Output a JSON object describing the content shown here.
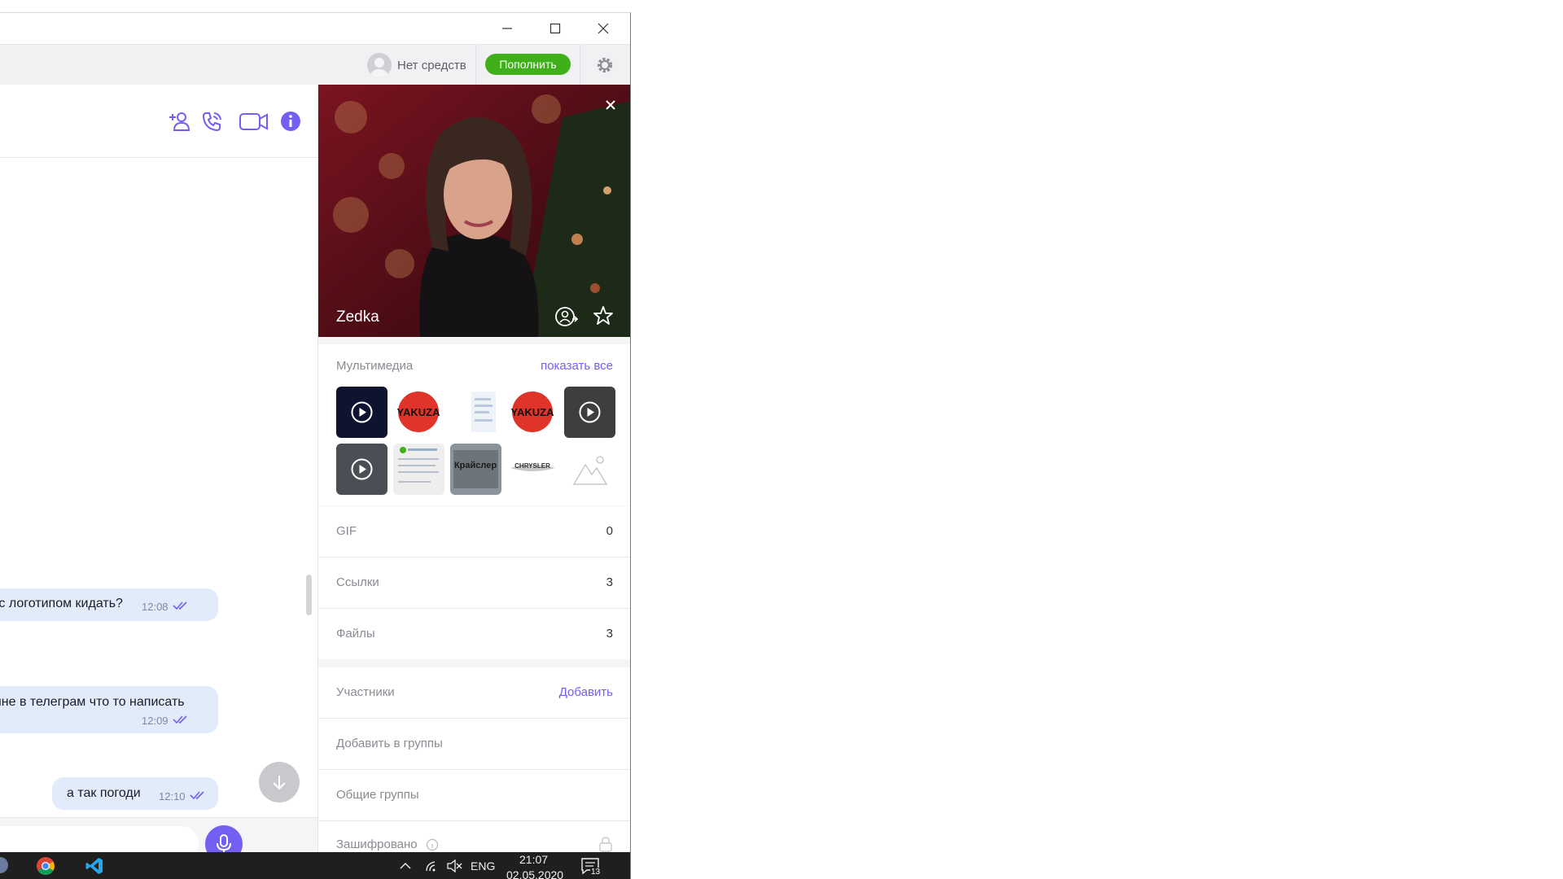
{
  "colors": {
    "accent": "#7360f2",
    "topup_green": "#3fb019",
    "bubble": "#e1ebfa"
  },
  "topbar": {
    "balance_text": "Нет средств",
    "topup_label": "Пополнить"
  },
  "chat": {
    "messages": [
      {
        "text": "ик с логотипом кидать?",
        "time": "12:08"
      },
      {
        "text": "ь мне в телеграм что то написать",
        "time": "12:09"
      },
      {
        "text": "а так погоди",
        "time": "12:10"
      }
    ]
  },
  "panel": {
    "contact_name": "Zedka",
    "media": {
      "label": "Мультимедиа",
      "show_all": "показать все",
      "thumbs": [
        {
          "kind": "video"
        },
        {
          "kind": "image",
          "caption": "YAKUZA"
        },
        {
          "kind": "image"
        },
        {
          "kind": "image",
          "caption": "YAKUZA"
        },
        {
          "kind": "video"
        },
        {
          "kind": "video"
        },
        {
          "kind": "image"
        },
        {
          "kind": "image",
          "caption": "Крайслер"
        },
        {
          "kind": "image",
          "caption": "CHRYSLER"
        },
        {
          "kind": "placeholder"
        }
      ]
    },
    "gif": {
      "label": "GIF",
      "count": "0"
    },
    "links": {
      "label": "Ссылки",
      "count": "3"
    },
    "files": {
      "label": "Файлы",
      "count": "3"
    },
    "participants": {
      "label": "Участники",
      "action": "Добавить"
    },
    "add_to_groups": "Добавить в группы",
    "common_groups": "Общие группы",
    "encrypted": "Зашифровано"
  },
  "taskbar": {
    "lang": "ENG",
    "time": "21:07",
    "date": "02.05.2020",
    "notif_count": "13"
  }
}
